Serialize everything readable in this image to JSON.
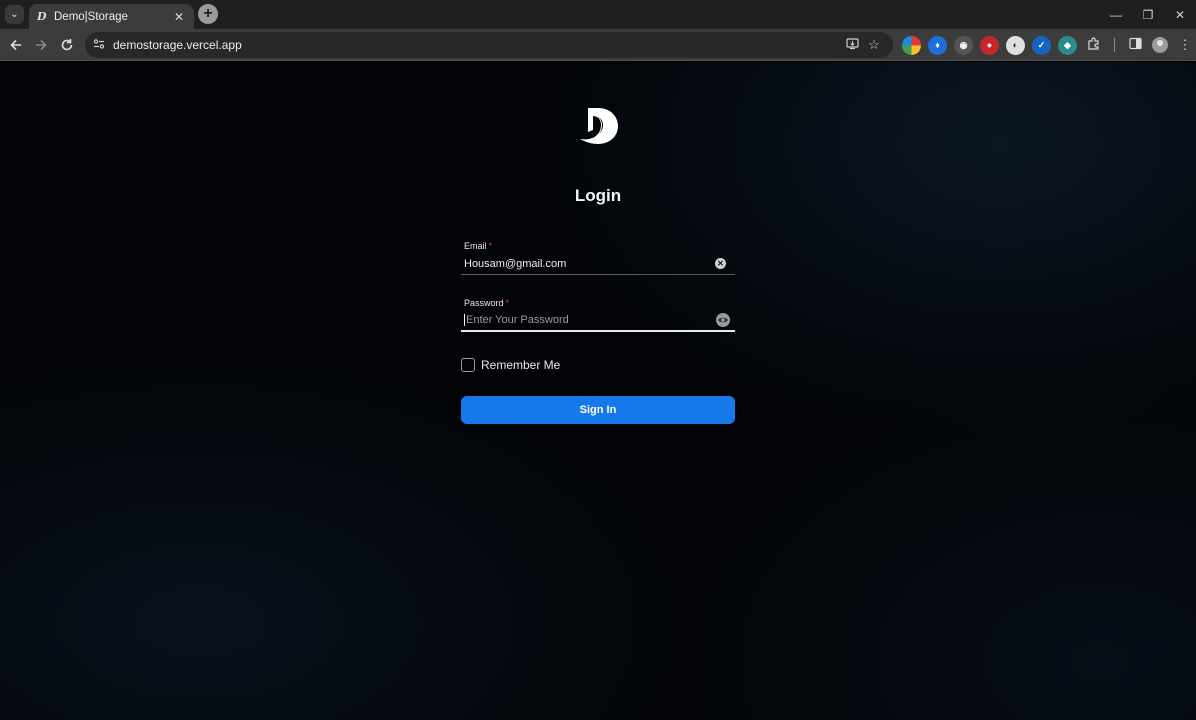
{
  "browser": {
    "tab_title": "Demo|Storage",
    "tab_favicon": "D",
    "tab_close": "✕",
    "new_tab": "+",
    "url": "demostorage.vercel.app",
    "window_controls": {
      "minimize": "—",
      "restore": "❐",
      "close": "✕"
    }
  },
  "login": {
    "title": "Login",
    "email_label": "Email",
    "email_value": "Housam@gmail.com",
    "password_label": "Password",
    "password_placeholder": "Enter Your Password",
    "required_mark": "*",
    "remember_label": "Remember Me",
    "signin_label": "Sign In"
  },
  "colors": {
    "accent": "#1579ea",
    "background": "#020407",
    "required": "#e53935"
  },
  "icons": [
    "tab-search-icon",
    "back-icon",
    "forward-icon",
    "reload-icon",
    "site-info-icon",
    "install-app-icon",
    "bookmark-star-icon",
    "extensions-icon",
    "side-panel-icon",
    "profile-icon",
    "menu-icon",
    "clear-icon",
    "eye-icon"
  ]
}
